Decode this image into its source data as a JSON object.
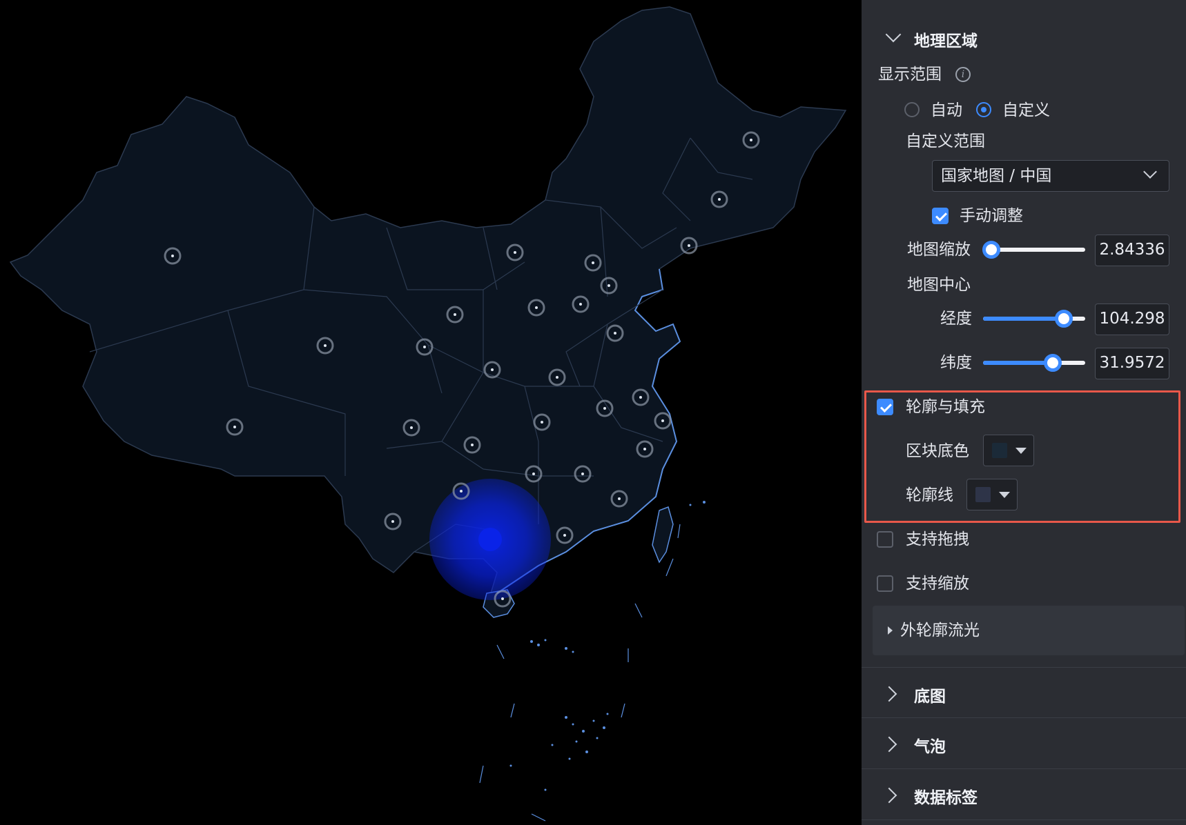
{
  "panel": {
    "geo_section": {
      "title": "地理区域"
    },
    "display_range": {
      "label": "显示范围",
      "info_icon": "info-icon"
    },
    "mode_options": [
      {
        "label": "自动",
        "selected": false
      },
      {
        "label": "自定义",
        "selected": true
      }
    ],
    "custom_range": {
      "label": "自定义范围",
      "value": "国家地图 / 中国"
    },
    "manual_adjust": {
      "label": "手动调整",
      "checked": true
    },
    "zoom": {
      "label": "地图缩放",
      "value": "2.84336",
      "level": 0.08
    },
    "center": {
      "label": "地图中心",
      "longitude": {
        "label": "经度",
        "value": "104.298",
        "level": 0.79
      },
      "latitude": {
        "label": "纬度",
        "value": "31.9572",
        "level": 0.68
      }
    },
    "outline_fill": {
      "label": "轮廓与填充",
      "checked": true,
      "block_color": {
        "label": "区块底色",
        "color": "#1b2a38"
      },
      "outline": {
        "label": "轮廓线",
        "color": "#2e3448"
      }
    },
    "drag": {
      "label": "支持拖拽",
      "checked": false
    },
    "zoom_support": {
      "label": "支持缩放",
      "checked": false
    },
    "glow": {
      "label": "外轮廓流光"
    },
    "sections": [
      {
        "label": "底图"
      },
      {
        "label": "气泡"
      },
      {
        "label": "数据标签"
      }
    ]
  },
  "colors": {
    "accent": "#3d8bff",
    "panel_bg": "#2b2d33",
    "highlight": "#e8584a",
    "map_fill": "#0b1420",
    "map_border": "#2c3a50",
    "coast": "#5b8fe0",
    "bubble": "#0a23e8"
  }
}
